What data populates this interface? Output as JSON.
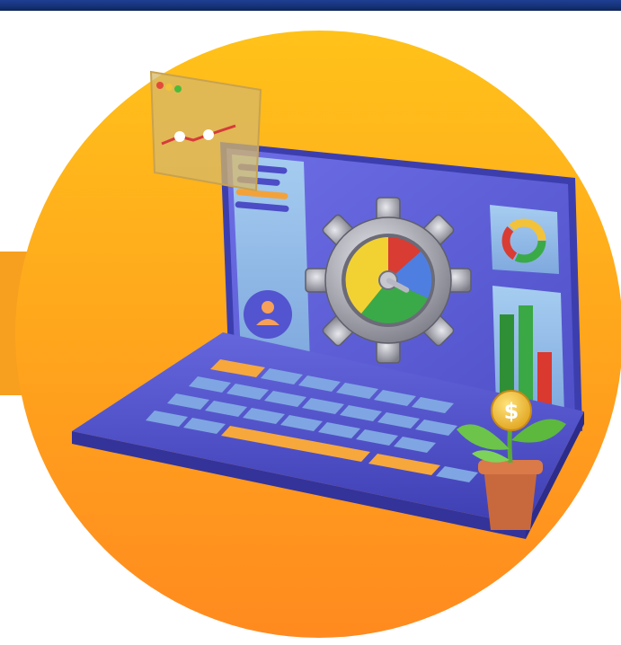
{
  "illustration": {
    "subject": "laptop-dashboard-with-gear-and-money-plant",
    "symbol": "$",
    "colors": {
      "header_bar": "#163277",
      "band": "#f7a01f",
      "circle_top": "#ffc21a",
      "circle_bottom": "#ff8a1f",
      "laptop": "#5b5cd6",
      "screen_panel": "#8fb8e6",
      "key_accent": "#f6a83c",
      "gear": "#9a9aa5",
      "coin": "#f2c23b",
      "plant": "#6cc44a",
      "pot": "#c8693d",
      "bar_green": "#2f9a3a",
      "bar_red": "#d9392f"
    }
  }
}
